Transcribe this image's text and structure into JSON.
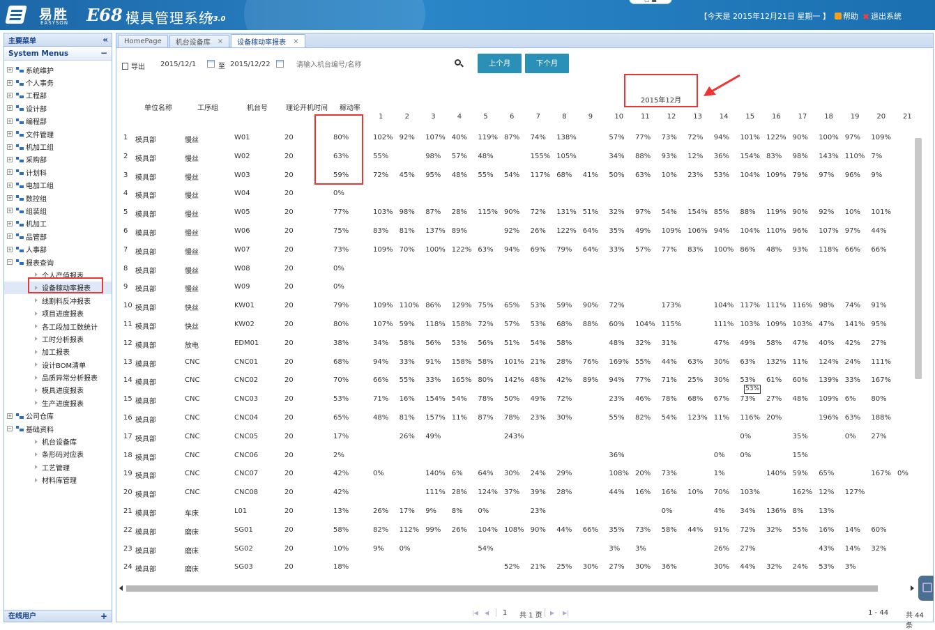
{
  "header": {
    "brand": "易胜",
    "brand_en": "EASYSON",
    "system_code": "E68",
    "system_name": "模具管理系统",
    "version": "V3.0",
    "top_tab": "▢ ■",
    "date_text": "【今天是 2015年12月21日 星期一 】",
    "help_label": "帮助",
    "exit_label": "退出系统"
  },
  "sidebar": {
    "title": "主要菜单",
    "collapse": "«",
    "subtitle": "System Menus",
    "sub_toggle": "−",
    "items": [
      {
        "label": "系统维护",
        "exp": "+"
      },
      {
        "label": "个人事务",
        "exp": "+"
      },
      {
        "label": "工程部",
        "exp": "+"
      },
      {
        "label": "设计部",
        "exp": "+"
      },
      {
        "label": "编程部",
        "exp": "+"
      },
      {
        "label": "文件管理",
        "exp": "+"
      },
      {
        "label": "机加工组",
        "exp": "+"
      },
      {
        "label": "采购部",
        "exp": "+"
      },
      {
        "label": "计划科",
        "exp": "+"
      },
      {
        "label": "电加工组",
        "exp": "+"
      },
      {
        "label": "数控组",
        "exp": "+"
      },
      {
        "label": "组装组",
        "exp": "+"
      },
      {
        "label": "机加工",
        "exp": "+"
      },
      {
        "label": "品管部",
        "exp": "+"
      },
      {
        "label": "人事部",
        "exp": "+"
      },
      {
        "label": "报表查询",
        "exp": "−"
      }
    ],
    "report_children": [
      "个人产值报表",
      "设备稼动率报表",
      "线割料反冲报表",
      "项目进度报表",
      "各工段加工数统计",
      "工时分析报表",
      "加工报表",
      "设计BOM清单",
      "品质异常分析报表",
      "模具进度报表",
      "生产进度报表"
    ],
    "after_items": [
      {
        "label": "公司仓库",
        "exp": "+"
      },
      {
        "label": "基础资料",
        "exp": "−"
      }
    ],
    "base_children": [
      "机台设备库",
      "条形码对应表",
      "工艺管理",
      "材料库管理"
    ],
    "online": "在线用户",
    "online_toggle": "+"
  },
  "tabs": [
    {
      "label": "HomePage",
      "close": ""
    },
    {
      "label": "机台设备库",
      "close": "×"
    },
    {
      "label": "设备稼动率报表",
      "close": "×"
    }
  ],
  "toolbar": {
    "export": "导出",
    "date_from": "2015/12/1",
    "to": "至",
    "date_to": "2015/12/22",
    "search_placeholder": "请输入机台编号/名称",
    "prev_month": "上个月",
    "next_month": "下个月"
  },
  "table": {
    "month_label": "2015年12月",
    "columns": [
      "单位名称",
      "工序组",
      "机台号",
      "理论开机时间",
      "稼动率"
    ],
    "days": [
      "1",
      "2",
      "3",
      "4",
      "5",
      "6",
      "7",
      "8",
      "9",
      "10",
      "11",
      "12",
      "13",
      "14",
      "15",
      "16",
      "17",
      "18",
      "19",
      "20",
      "21"
    ],
    "rows": [
      {
        "n": "1",
        "u": "模具部",
        "g": "慢丝",
        "m": "W01",
        "t": "20",
        "r": "80%",
        "d": [
          "102%",
          "92%",
          "107%",
          "40%",
          "119%",
          "87%",
          "74%",
          "138%",
          "",
          "57%",
          "77%",
          "73%",
          "72%",
          "94%",
          "101%",
          "122%",
          "90%",
          "100%",
          "97%",
          "109%",
          ""
        ]
      },
      {
        "n": "2",
        "u": "模具部",
        "g": "慢丝",
        "m": "W02",
        "t": "20",
        "r": "63%",
        "d": [
          "55%",
          "",
          "98%",
          "57%",
          "48%",
          "",
          "155%",
          "105%",
          "",
          "34%",
          "88%",
          "93%",
          "12%",
          "36%",
          "154%",
          "83%",
          "98%",
          "143%",
          "110%",
          "7%",
          ""
        ]
      },
      {
        "n": "3",
        "u": "模具部",
        "g": "慢丝",
        "m": "W03",
        "t": "20",
        "r": "59%",
        "d": [
          "72%",
          "45%",
          "95%",
          "48%",
          "55%",
          "54%",
          "117%",
          "68%",
          "41%",
          "50%",
          "63%",
          "10%",
          "23%",
          "53%",
          "104%",
          "109%",
          "79%",
          "97%",
          "96%",
          "9%",
          ""
        ]
      },
      {
        "n": "4",
        "u": "模具部",
        "g": "慢丝",
        "m": "W04",
        "t": "20",
        "r": "0%",
        "d": [
          "",
          "",
          "",
          "",
          "",
          "",
          "",
          "",
          "",
          "",
          "",
          "",
          "",
          "",
          "",
          "",
          "",
          "",
          "",
          "",
          ""
        ]
      },
      {
        "n": "5",
        "u": "模具部",
        "g": "慢丝",
        "m": "W05",
        "t": "20",
        "r": "77%",
        "d": [
          "103%",
          "98%",
          "87%",
          "28%",
          "115%",
          "90%",
          "72%",
          "131%",
          "51%",
          "32%",
          "97%",
          "54%",
          "154%",
          "85%",
          "88%",
          "119%",
          "90%",
          "92%",
          "10%",
          "101%",
          ""
        ]
      },
      {
        "n": "6",
        "u": "模具部",
        "g": "慢丝",
        "m": "W06",
        "t": "20",
        "r": "75%",
        "d": [
          "83%",
          "81%",
          "137%",
          "89%",
          "",
          "92%",
          "26%",
          "122%",
          "64%",
          "35%",
          "49%",
          "109%",
          "106%",
          "94%",
          "104%",
          "110%",
          "96%",
          "107%",
          "97%",
          "44%",
          ""
        ]
      },
      {
        "n": "7",
        "u": "模具部",
        "g": "慢丝",
        "m": "W07",
        "t": "20",
        "r": "73%",
        "d": [
          "109%",
          "70%",
          "100%",
          "122%",
          "63%",
          "94%",
          "69%",
          "79%",
          "64%",
          "33%",
          "57%",
          "77%",
          "83%",
          "100%",
          "86%",
          "48%",
          "93%",
          "118%",
          "66%",
          "66%",
          ""
        ]
      },
      {
        "n": "8",
        "u": "模具部",
        "g": "慢丝",
        "m": "W08",
        "t": "20",
        "r": "0%",
        "d": [
          "",
          "",
          "",
          "",
          "",
          "",
          "",
          "",
          "",
          "",
          "",
          "",
          "",
          "",
          "",
          "",
          "",
          "",
          "",
          "",
          ""
        ]
      },
      {
        "n": "9",
        "u": "模具部",
        "g": "慢丝",
        "m": "W09",
        "t": "20",
        "r": "0%",
        "d": [
          "",
          "",
          "",
          "",
          "",
          "",
          "",
          "",
          "",
          "",
          "",
          "",
          "",
          "",
          "",
          "",
          "",
          "",
          "",
          "",
          ""
        ]
      },
      {
        "n": "10",
        "u": "模具部",
        "g": "快丝",
        "m": "KW01",
        "t": "20",
        "r": "79%",
        "d": [
          "109%",
          "110%",
          "86%",
          "129%",
          "75%",
          "65%",
          "53%",
          "59%",
          "90%",
          "72%",
          "",
          "173%",
          "",
          "104%",
          "117%",
          "111%",
          "116%",
          "98%",
          "74%",
          "91%",
          ""
        ]
      },
      {
        "n": "11",
        "u": "模具部",
        "g": "快丝",
        "m": "KW02",
        "t": "20",
        "r": "80%",
        "d": [
          "107%",
          "59%",
          "118%",
          "158%",
          "72%",
          "57%",
          "53%",
          "68%",
          "88%",
          "60%",
          "104%",
          "115%",
          "",
          "111%",
          "103%",
          "109%",
          "103%",
          "47%",
          "141%",
          "95%",
          ""
        ]
      },
      {
        "n": "12",
        "u": "模具部",
        "g": "放电",
        "m": "EDM01",
        "t": "20",
        "r": "38%",
        "d": [
          "34%",
          "58%",
          "56%",
          "53%",
          "56%",
          "51%",
          "54%",
          "58%",
          "",
          "48%",
          "32%",
          "31%",
          "",
          "47%",
          "49%",
          "58%",
          "47%",
          "40%",
          "42%",
          "27%",
          ""
        ]
      },
      {
        "n": "13",
        "u": "模具部",
        "g": "CNC",
        "m": "CNC01",
        "t": "20",
        "r": "68%",
        "d": [
          "94%",
          "33%",
          "91%",
          "158%",
          "58%",
          "101%",
          "21%",
          "28%",
          "76%",
          "169%",
          "55%",
          "44%",
          "63%",
          "30%",
          "63%",
          "132%",
          "11%",
          "124%",
          "24%",
          "111%",
          ""
        ]
      },
      {
        "n": "14",
        "u": "模具部",
        "g": "CNC",
        "m": "CNC02",
        "t": "20",
        "r": "70%",
        "d": [
          "66%",
          "55%",
          "33%",
          "165%",
          "80%",
          "142%",
          "48%",
          "42%",
          "89%",
          "94%",
          "77%",
          "71%",
          "25%",
          "30%",
          "53%",
          "61%",
          "60%",
          "139%",
          "33%",
          "167%",
          ""
        ]
      },
      {
        "n": "15",
        "u": "模具部",
        "g": "CNC",
        "m": "CNC03",
        "t": "20",
        "r": "53%",
        "d": [
          "71%",
          "16%",
          "154%",
          "54%",
          "78%",
          "50%",
          "49%",
          "72%",
          "",
          "23%",
          "46%",
          "78%",
          "68%",
          "67%",
          "73%",
          "27%",
          "48%",
          "109%",
          "6%",
          "80%",
          ""
        ]
      },
      {
        "n": "16",
        "u": "模具部",
        "g": "CNC",
        "m": "CNC04",
        "t": "20",
        "r": "65%",
        "d": [
          "48%",
          "81%",
          "157%",
          "11%",
          "87%",
          "78%",
          "23%",
          "30%",
          "",
          "55%",
          "82%",
          "54%",
          "123%",
          "11%",
          "116%",
          "20%",
          "",
          "196%",
          "63%",
          "188%",
          ""
        ]
      },
      {
        "n": "17",
        "u": "模具部",
        "g": "CNC",
        "m": "CNC05",
        "t": "20",
        "r": "17%",
        "d": [
          "",
          "26%",
          "49%",
          "",
          "",
          "243%",
          "",
          "",
          "",
          "",
          "",
          "",
          "",
          "",
          "0%",
          "",
          "35%",
          "",
          "0%",
          "27%",
          ""
        ]
      },
      {
        "n": "18",
        "u": "模具部",
        "g": "CNC",
        "m": "CNC06",
        "t": "20",
        "r": "2%",
        "d": [
          "",
          "",
          "",
          "",
          "",
          "",
          "",
          "",
          "",
          "36%",
          "",
          "",
          "",
          "0%",
          "0%",
          "",
          "15%",
          "",
          "",
          "",
          ""
        ]
      },
      {
        "n": "19",
        "u": "模具部",
        "g": "CNC",
        "m": "CNC07",
        "t": "20",
        "r": "42%",
        "d": [
          "0%",
          "",
          "140%",
          "6%",
          "64%",
          "30%",
          "24%",
          "29%",
          "",
          "108%",
          "20%",
          "73%",
          "",
          "1%",
          "",
          "140%",
          "59%",
          "65%",
          "",
          "167%",
          "0%"
        ]
      },
      {
        "n": "20",
        "u": "模具部",
        "g": "CNC",
        "m": "CNC08",
        "t": "20",
        "r": "42%",
        "d": [
          "",
          "",
          "111%",
          "28%",
          "124%",
          "37%",
          "39%",
          "28%",
          "",
          "44%",
          "16%",
          "16%",
          "10%",
          "70%",
          "103%",
          "",
          "162%",
          "12%",
          "127%",
          "",
          ""
        ]
      },
      {
        "n": "21",
        "u": "模具部",
        "g": "车床",
        "m": "L01",
        "t": "20",
        "r": "13%",
        "d": [
          "26%",
          "17%",
          "9%",
          "8%",
          "0%",
          "",
          "23%",
          "",
          "",
          "",
          "",
          "0%",
          "",
          "4%",
          "34%",
          "136%",
          "8%",
          "13%",
          "",
          "",
          ""
        ]
      },
      {
        "n": "22",
        "u": "模具部",
        "g": "磨床",
        "m": "SG01",
        "t": "20",
        "r": "58%",
        "d": [
          "82%",
          "112%",
          "99%",
          "26%",
          "104%",
          "108%",
          "90%",
          "44%",
          "66%",
          "35%",
          "73%",
          "58%",
          "44%",
          "91%",
          "72%",
          "32%",
          "55%",
          "16%",
          "14%",
          "60%",
          ""
        ]
      },
      {
        "n": "23",
        "u": "模具部",
        "g": "磨床",
        "m": "SG02",
        "t": "20",
        "r": "10%",
        "d": [
          "9%",
          "0%",
          "",
          "",
          "54%",
          "",
          "",
          "",
          "",
          "3%",
          "3%",
          "",
          "",
          "26%",
          "27%",
          "",
          "",
          "43%",
          "14%",
          "32%",
          ""
        ]
      },
      {
        "n": "24",
        "u": "模具部",
        "g": "磨床",
        "m": "SG03",
        "t": "20",
        "r": "18%",
        "d": [
          "",
          "",
          "",
          "",
          "",
          "52%",
          "21%",
          "25%",
          "30%",
          "27%",
          "30%",
          "36%",
          "",
          "30%",
          "44%",
          "32%",
          "24%",
          "53%",
          "3%",
          "",
          ""
        ]
      }
    ],
    "tooltip": "53%"
  },
  "pager": {
    "first": "|◀",
    "prev": "◀",
    "page": "1",
    "total_pages": "共 1 页",
    "next": "▶",
    "last": "▶|",
    "range": "1 - 44",
    "total": "共 44 条"
  },
  "colors": {
    "header_bg": "#1c67a8",
    "button_bg": "#2a90b8",
    "highlight_red": "#e33"
  }
}
